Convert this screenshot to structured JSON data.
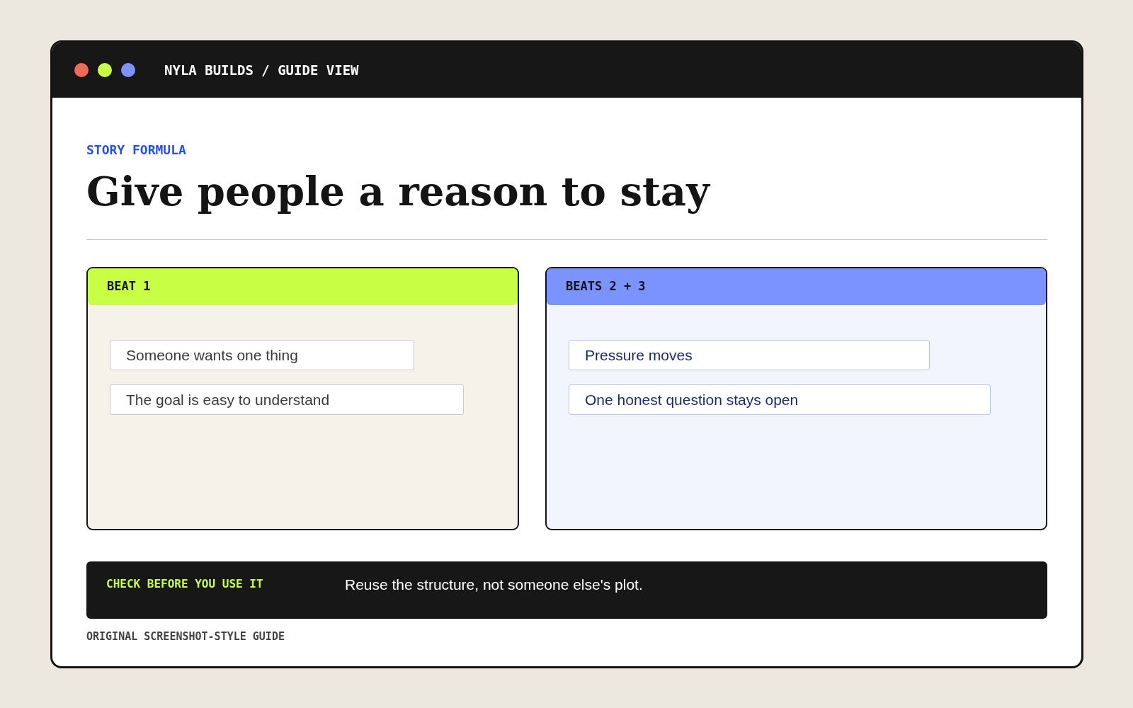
{
  "window": {
    "title": "NYLA BUILDS / GUIDE VIEW"
  },
  "eyebrow": "STORY FORMULA",
  "heading": "Give people a reason to stay",
  "cards": [
    {
      "label": "BEAT 1",
      "color": "#c8ff45",
      "items": [
        "Someone wants one thing",
        "The goal is easy to understand"
      ]
    },
    {
      "label": "BEATS 2 + 3",
      "color": "#7b93ff",
      "items": [
        "Pressure moves",
        "One honest question stays open"
      ]
    }
  ],
  "callout": {
    "label": "CHECK BEFORE YOU USE IT",
    "text": "Reuse the structure, not someone else's plot."
  },
  "caption": "ORIGINAL SCREENSHOT-STYLE GUIDE"
}
